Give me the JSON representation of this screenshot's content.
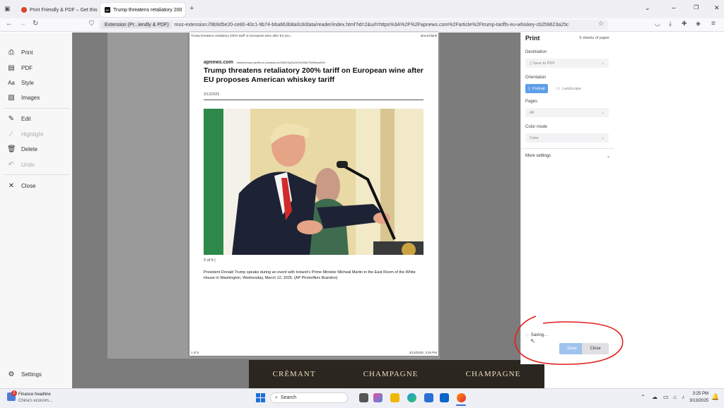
{
  "tabs": [
    {
      "title": "Print Friendly & PDF – Get this",
      "active": false
    },
    {
      "title": "Trump threatens retaliatory 200",
      "active": true
    }
  ],
  "tab_new_label": "+",
  "window_controls": {
    "minimize": "–",
    "restore": "❐",
    "close": "✕"
  },
  "url": {
    "extension_label": "Extension (Pr...iendly & PDF)",
    "text": "moz-extension://9b9d5e20-ce80-40c1-9b74-b6a663b8a0c8/data/reader/index.html?id=2&url=https%3A%2F%2Fapnews.com%2Farticle%2Ftrump-tariffs-eu-whiskey-cb259623a25c"
  },
  "sidebar": {
    "items": [
      {
        "label": "Print",
        "icon": "printer-icon",
        "enabled": true
      },
      {
        "label": "PDF",
        "icon": "pdf-icon",
        "enabled": true
      },
      {
        "label": "Style",
        "icon": "style-icon",
        "enabled": true
      },
      {
        "label": "Images",
        "icon": "image-icon",
        "enabled": true
      },
      {
        "label": "Edit",
        "icon": "edit-icon",
        "enabled": true
      },
      {
        "label": "Highlight",
        "icon": "highlight-icon",
        "enabled": false
      },
      {
        "label": "Delete",
        "icon": "trash-icon",
        "enabled": true
      },
      {
        "label": "Undo",
        "icon": "undo-icon",
        "enabled": false
      },
      {
        "label": "Close",
        "icon": "close-icon",
        "enabled": true
      }
    ],
    "settings_label": "Settings"
  },
  "page": {
    "header_left": "Trump threatens retaliatory 200% tariff on European wine after EU pro...",
    "header_right": "about:blank",
    "source": "apnews.com",
    "source_url": "/article/trump-tariffs-eu-whiskey-cb259623a25c5f7eb9f4b7f02f5bea599",
    "headline": "Trump threatens retaliatory 200% tariff on European wine after EU proposes American whiskey tariff",
    "date": "3/13/2025",
    "photo_counter": "2 of 5 |",
    "caption": "President Donald Trump speaks during an event with Ireland's Prime Minister Micheál Martin in the East Room of the White House in Washington, Wednesday, March 12, 2025. (AP Photo/Alex Brandon)",
    "footer_left": "1 of 5",
    "footer_right": "3/13/2025, 3:25 PM"
  },
  "background_strip": [
    "CRÉMANT",
    "CHAMPAGNE",
    "CHAMPAGNE"
  ],
  "print_panel": {
    "title": "Print",
    "sheets": "5 sheets of paper",
    "destination_label": "Destination",
    "destination_value": "Save to PDF",
    "orientation_label": "Orientation",
    "portrait_label": "Portrait",
    "landscape_label": "Landscape",
    "pages_label": "Pages",
    "pages_value": "All",
    "color_mode_label": "Color mode",
    "color_mode_value": "Color",
    "more_settings_label": "More settings",
    "status": "Saving...",
    "save_label": "Save",
    "close_label": "Close"
  },
  "taskbar": {
    "news_title": "Finance headline",
    "news_sub": "China's econom...",
    "news_badge": "2",
    "search_placeholder": "Search",
    "time": "3:25 PM",
    "date": "3/13/2025"
  },
  "colors": {
    "accent": "#0060df",
    "annotation": "#e0201c",
    "preview_bg": "#7c7c7c"
  }
}
